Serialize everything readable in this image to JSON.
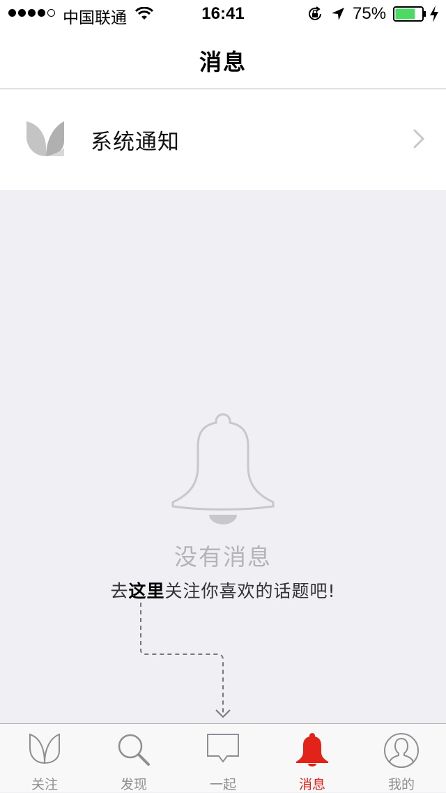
{
  "status_bar": {
    "carrier": "中国联通",
    "time": "16:41",
    "battery_percent": "75%",
    "battery_level": 0.75,
    "signal_bars_filled": 4,
    "signal_bars_total": 5
  },
  "nav": {
    "title": "消息"
  },
  "notification_row": {
    "label": "系统通知",
    "icon": "leaf-icon"
  },
  "empty_state": {
    "icon": "bell-outline-icon",
    "title": "没有消息",
    "hint_prefix": "去",
    "hint_link": "这里",
    "hint_suffix": "关注你喜欢的话题吧!"
  },
  "tab_bar": {
    "active_color": "#e2231a",
    "inactive_color": "#8e8e93",
    "tabs": [
      {
        "label": "关注",
        "icon": "leaf-icon",
        "active": false
      },
      {
        "label": "发现",
        "icon": "search-icon",
        "active": false
      },
      {
        "label": "一起",
        "icon": "chat-bubble-icon",
        "active": false
      },
      {
        "label": "消息",
        "icon": "bell-icon",
        "active": true
      },
      {
        "label": "我的",
        "icon": "profile-icon",
        "active": false
      }
    ]
  }
}
